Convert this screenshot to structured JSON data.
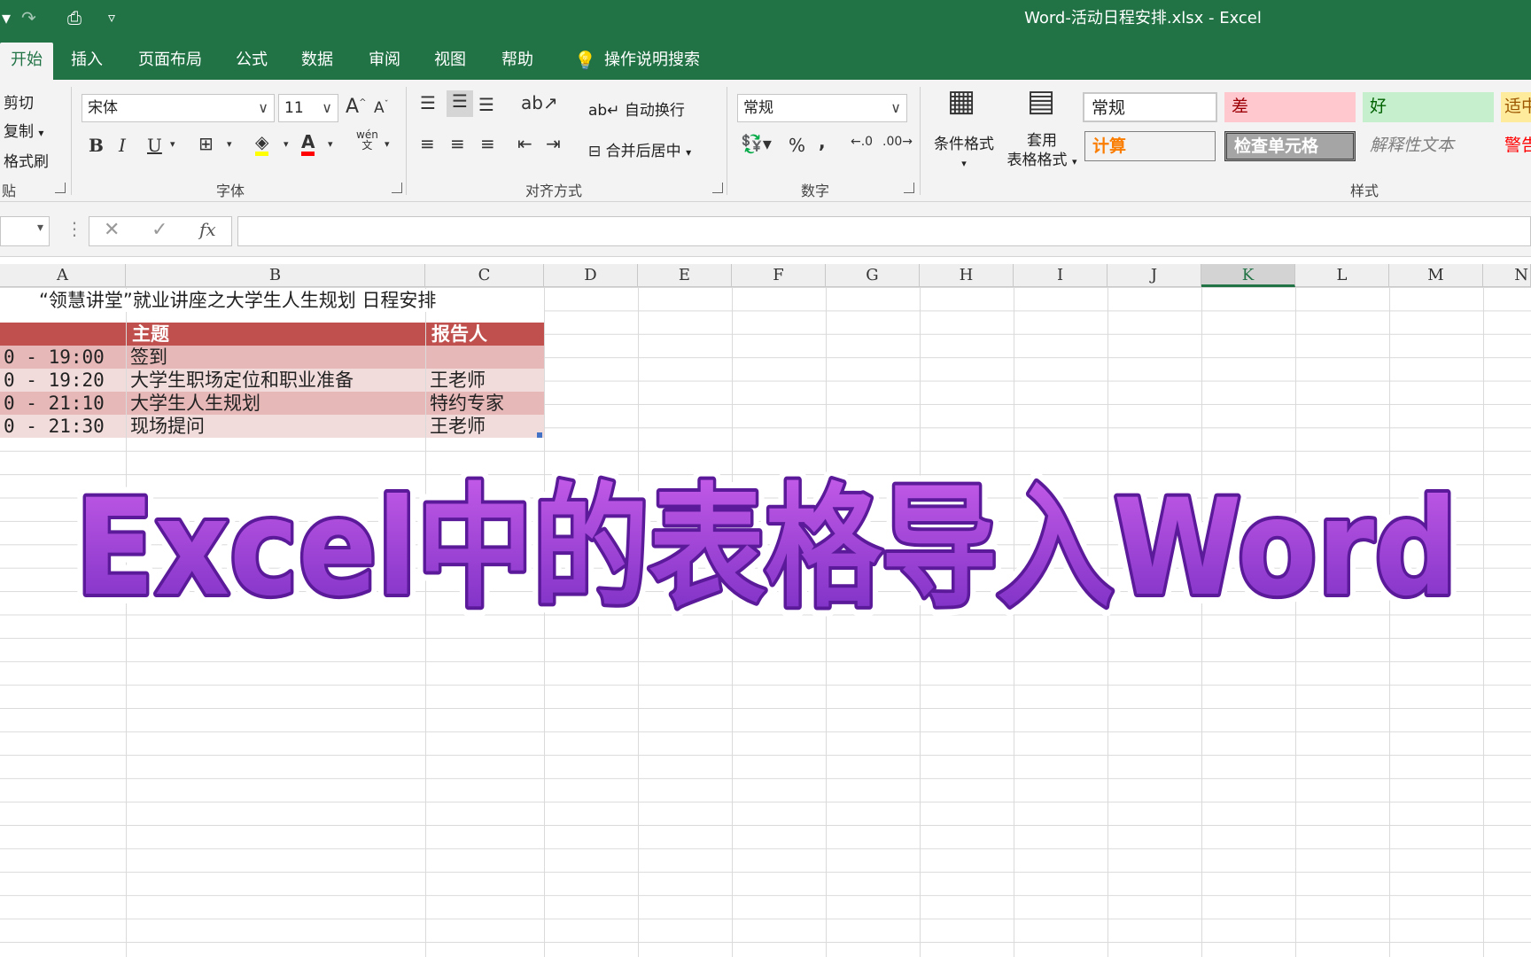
{
  "titlebar": {
    "doc_title": "Word-活动日程安排.xlsx  -  Excel",
    "qat_preview": "⎙",
    "qat_more": "▿"
  },
  "tabs": [
    {
      "label": "开始",
      "active": true
    },
    {
      "label": "插入"
    },
    {
      "label": "页面布局"
    },
    {
      "label": "公式"
    },
    {
      "label": "数据"
    },
    {
      "label": "审阅"
    },
    {
      "label": "视图"
    },
    {
      "label": "帮助"
    },
    {
      "label": "操作说明搜索"
    }
  ],
  "ribbon": {
    "clipboard": {
      "cut": "剪切",
      "copy": "复制",
      "format_painter": "格式刷",
      "label": "贴"
    },
    "font": {
      "name": "宋体",
      "size": "11",
      "bold": "B",
      "italic": "I",
      "underline": "U",
      "grow": "A",
      "shrink": "A",
      "font_color": "A",
      "phonetic": "wén",
      "label": "字体"
    },
    "alignment": {
      "wrap_text": "自动换行",
      "merge_center": "合并后居中",
      "label": "对齐方式"
    },
    "number": {
      "format": "常规",
      "percent": "%",
      "comma": ",",
      "label": "数字"
    },
    "styles": {
      "conditional": "条件格式",
      "table_format_1": "套用",
      "table_format_2": "表格格式",
      "cells": [
        {
          "text": "常规",
          "bg": "#ffffff",
          "color": "#222222"
        },
        {
          "text": "差",
          "bg": "#ffc7ce",
          "color": "#9c0006"
        },
        {
          "text": "好",
          "bg": "#c6efce",
          "color": "#006100"
        },
        {
          "text": "适中",
          "bg": "#ffeb9c",
          "color": "#9c5700"
        },
        {
          "text": "计算",
          "bg": "#f2f2f2",
          "color": "#fa7d00"
        },
        {
          "text": "检查单元格",
          "bg": "#a5a5a5",
          "color": "#ffffff"
        },
        {
          "text": "解释性文本",
          "bg": "#f3f3f3",
          "color": "#7f7f7f"
        },
        {
          "text": "警告",
          "bg": "#f3f3f3",
          "color": "#ff0000"
        }
      ],
      "label": "样式"
    }
  },
  "formula_bar": {
    "cancel": "✕",
    "enter": "✓",
    "fx": "fx"
  },
  "columns": [
    "A",
    "B",
    "C",
    "D",
    "E",
    "F",
    "G",
    "H",
    "I",
    "J",
    "K",
    "L",
    "M",
    "N"
  ],
  "selected_column": "K",
  "sheet": {
    "title": "“领慧讲堂”就业讲座之大学生人生规划 日程安排",
    "header": {
      "col_a": "",
      "col_b": "主题",
      "col_c": "报告人"
    },
    "rows": [
      {
        "time": "0 - 19:00",
        "topic": "签到",
        "speaker": ""
      },
      {
        "time": "0 - 19:20",
        "topic": "大学生职场定位和职业准备",
        "speaker": "王老师"
      },
      {
        "time": "0 - 21:10",
        "topic": "大学生人生规划",
        "speaker": "特约专家"
      },
      {
        "time": "0 - 21:30",
        "topic": "现场提问",
        "speaker": "王老师"
      }
    ]
  },
  "overlay": {
    "text": "Excel中的表格导入Word"
  }
}
